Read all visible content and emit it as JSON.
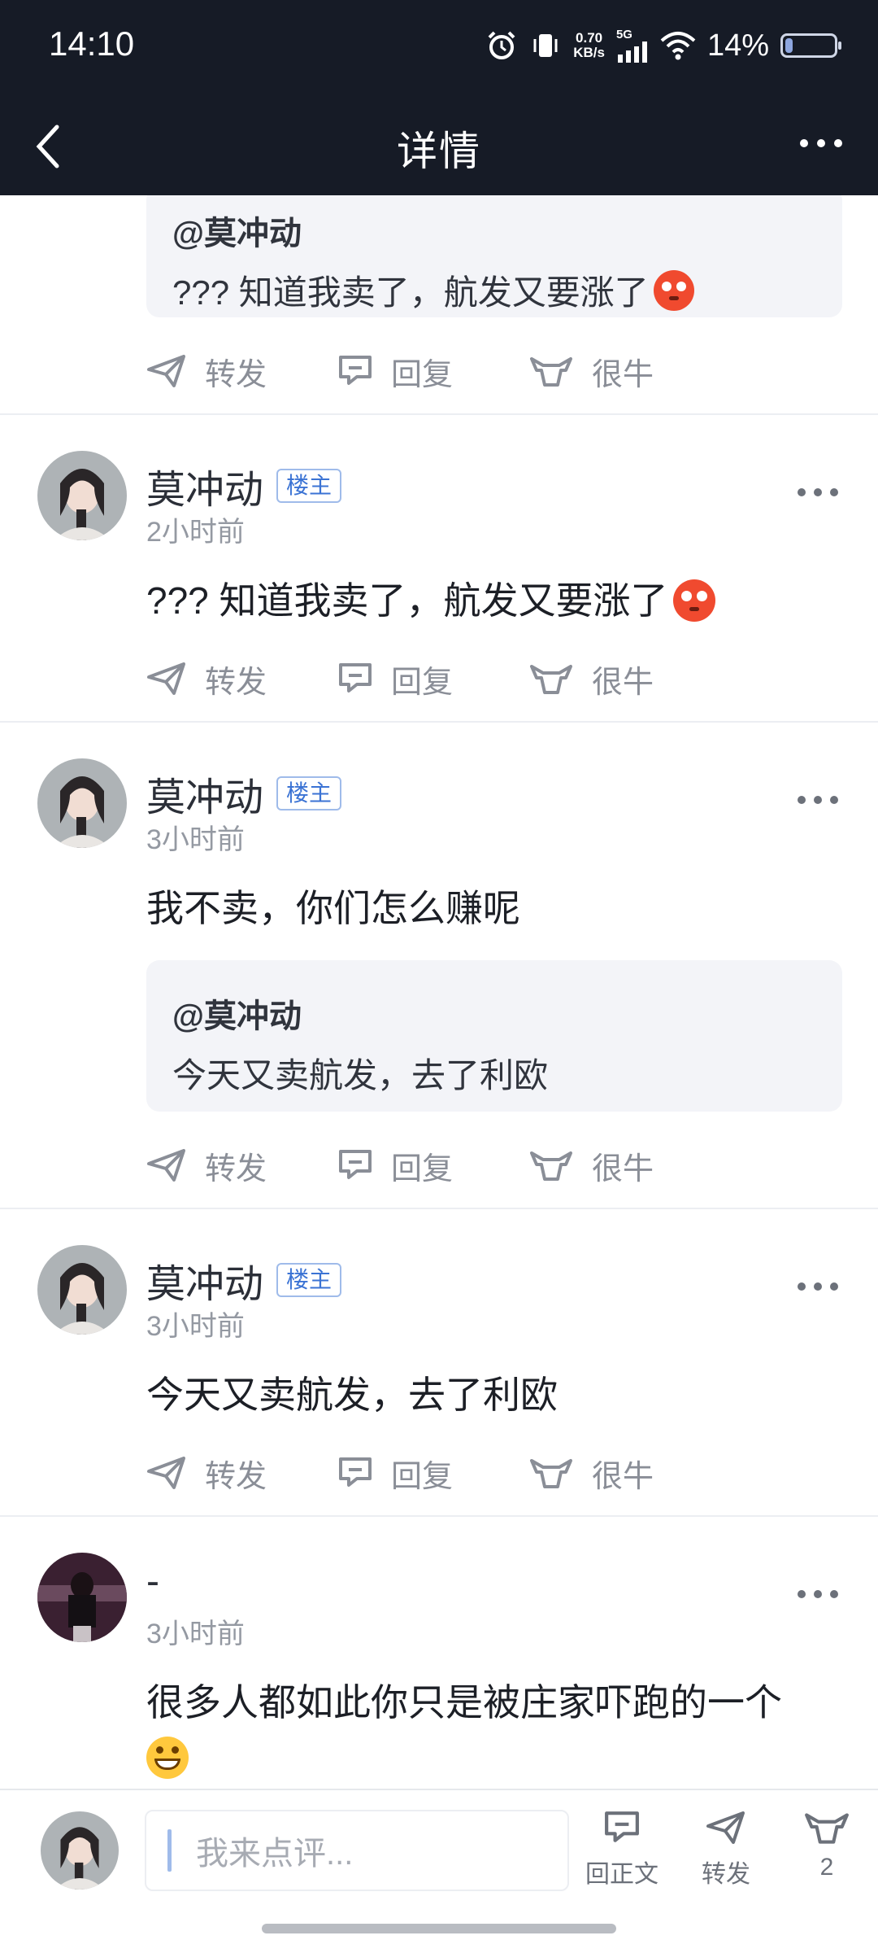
{
  "status": {
    "time": "14:10",
    "net_speed_value": "0.70",
    "net_speed_unit": "KB/s",
    "network": "5G",
    "battery_text": "14%",
    "battery_level": 0.14
  },
  "header": {
    "title": "详情",
    "back_icon": "chevron-left-icon",
    "more_icon": "more-horizontal-icon"
  },
  "actions": {
    "forward": "转发",
    "reply": "回复",
    "like": "很牛"
  },
  "top_quote": {
    "user": "@莫冲动",
    "text": "???  知道我卖了，航发又要涨了"
  },
  "posts": [
    {
      "author": "莫冲动",
      "badge": "楼主",
      "time": "2小时前",
      "text": "???  知道我卖了，航发又要涨了"
    },
    {
      "author": "莫冲动",
      "badge": "楼主",
      "time": "3小时前",
      "text": "我不卖，你们怎么赚呢",
      "quote": {
        "user": "@莫冲动",
        "text": "今天又卖航发，去了利欧"
      }
    },
    {
      "author": "莫冲动",
      "badge": "楼主",
      "time": "3小时前",
      "text": "今天又卖航发，去了利欧"
    },
    {
      "author": "-",
      "time": "3小时前",
      "text": "很多人都如此你只是被庄家吓跑的一个"
    }
  ],
  "bottom_bar": {
    "placeholder": "我来点评...",
    "reply_label": "回正文",
    "forward_label": "转发",
    "like_count": "2"
  },
  "colors": {
    "header_bg": "#161b26",
    "badge_blue": "#3b73d4",
    "quote_bg": "#f3f4f8",
    "action_gray": "#8a8e97"
  }
}
